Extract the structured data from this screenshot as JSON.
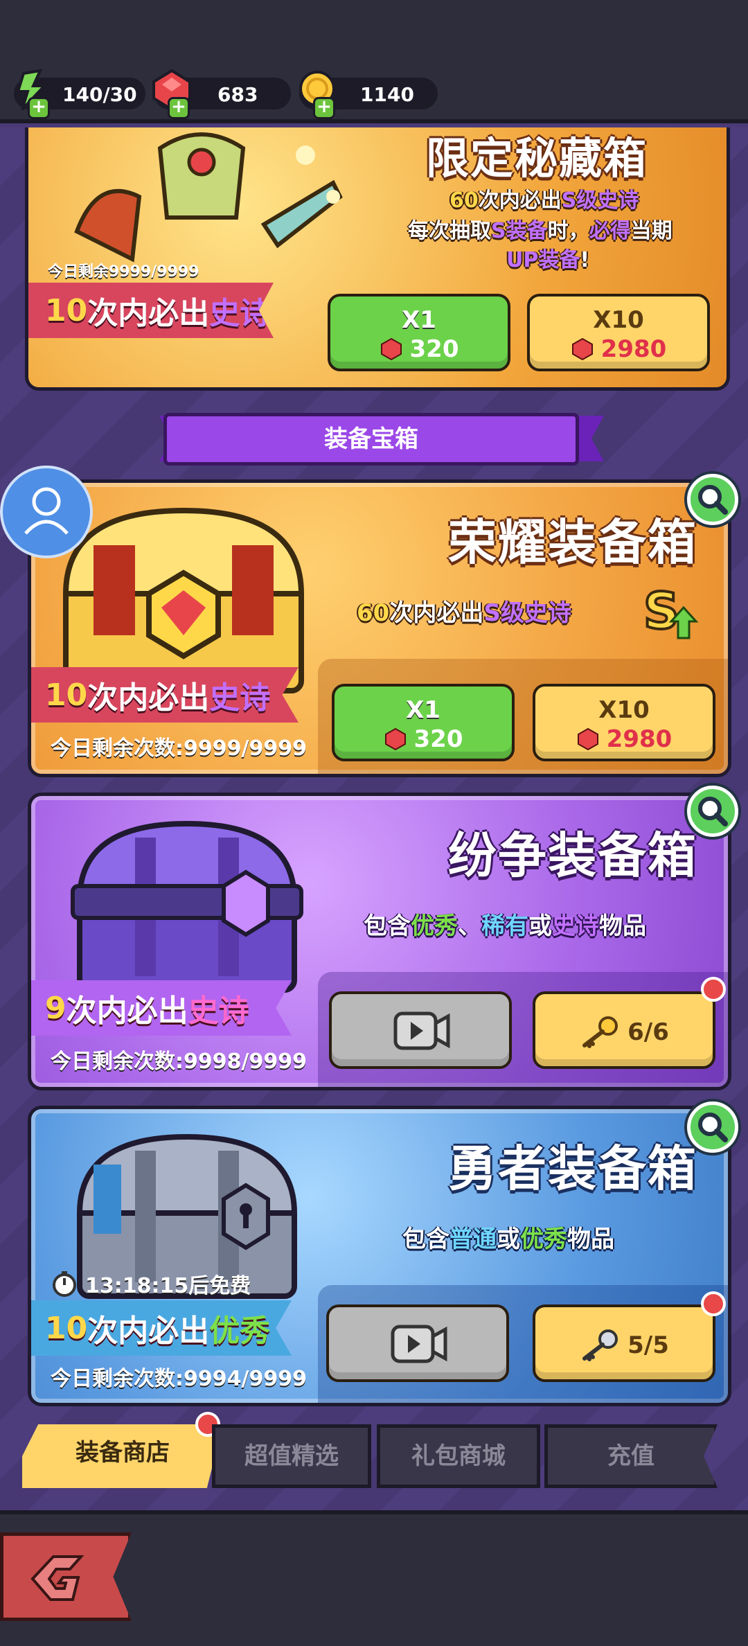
{
  "resources": {
    "energy": "140/30",
    "gems": "683",
    "coins": "1140"
  },
  "limited_box": {
    "title": "限定秘藏箱",
    "line1_num": "60",
    "line1_text": "次内必出",
    "line1_tier": "S级史诗",
    "line2_a": "每次抽取",
    "line2_b": "S装备",
    "line2_c": "时，",
    "line2_d": "必得",
    "line2_e": "当期",
    "line3_a": "UP装备",
    "line3_b": "!",
    "remain": "今日剩余9999/9999",
    "ribbon_num": "10",
    "ribbon_text": "次内必出",
    "ribbon_tier": "史诗",
    "btn1_label": "X1",
    "btn1_cost": "320",
    "btn2_label": "X10",
    "btn2_cost": "2980"
  },
  "section_title": "装备宝箱",
  "glory_box": {
    "title": "荣耀装备箱",
    "desc_num": "60",
    "desc_text": "次内必出",
    "desc_tier": "S级史诗",
    "ribbon_num": "10",
    "ribbon_text": "次内必出",
    "ribbon_tier": "史诗",
    "remain": "今日剩余次数:9999/9999",
    "btn1_label": "X1",
    "btn1_cost": "320",
    "btn2_label": "X10",
    "btn2_cost": "2980"
  },
  "strife_box": {
    "title": "纷争装备箱",
    "desc_a": "包含",
    "desc_b": "优秀",
    "desc_c": "、",
    "desc_d": "稀有",
    "desc_e": "或",
    "desc_f": "史诗",
    "desc_g": "物品",
    "ribbon_num": "9",
    "ribbon_text": "次内必出",
    "ribbon_tier": "史诗",
    "remain": "今日剩余次数:9998/9999",
    "key_count": "6/6"
  },
  "brave_box": {
    "title": "勇者装备箱",
    "desc_a": "包含",
    "desc_b": "普通",
    "desc_c": "或",
    "desc_d": "优秀",
    "desc_e": "物品",
    "timer": "13:18:15后免费",
    "ribbon_num": "10",
    "ribbon_text": "次内必出",
    "ribbon_tier": "优秀",
    "remain": "今日剩余次数:9994/9999",
    "key_count": "5/5"
  },
  "tabs": [
    "装备商店",
    "超值精选",
    "礼包商城",
    "充值"
  ],
  "colors": {
    "gold_button": "#ffd56a",
    "green_button": "#6cd24a",
    "epic_purple": "#c170ff",
    "good_green": "#7de04a"
  }
}
